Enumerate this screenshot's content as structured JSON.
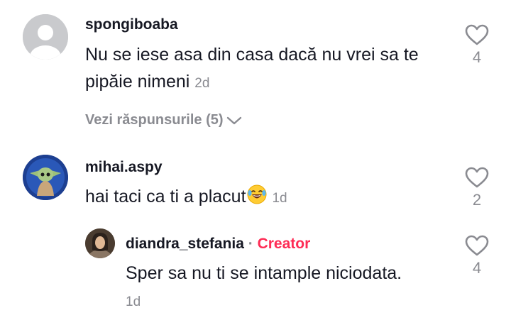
{
  "comments": [
    {
      "username": "spongiboaba",
      "text": "Nu se iese asa din casa dacă nu vrei sa te pipăie nimeni",
      "time": "2d",
      "likes": "4",
      "avatar_icon": "default-avatar-icon",
      "replies_label": "Vezi răspunsurile (5)"
    },
    {
      "username": "mihai.aspy",
      "text": "hai taci ca ti a placut",
      "emoji": "😂",
      "emoji_icon": "laughing-tears-emoji-icon",
      "time": "1d",
      "likes": "2",
      "avatar_icon": "baby-yoda-avatar-icon"
    }
  ],
  "reply": {
    "username": "diandra_stefania",
    "separator": "·",
    "badge": "Creator",
    "text": "Sper sa nu ti se intample niciodata.",
    "time": "1d",
    "likes": "4",
    "avatar_icon": "user-photo-avatar-icon"
  },
  "colors": {
    "text": "#161823",
    "secondary": "#8a8b91",
    "creator": "#fe2c55"
  }
}
